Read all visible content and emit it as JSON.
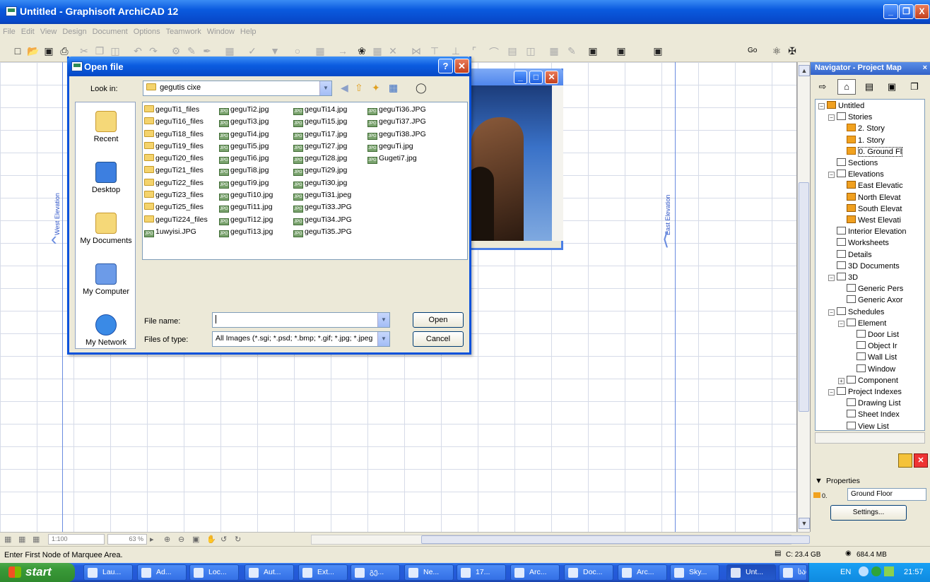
{
  "app": {
    "title": "Untitled - Graphisoft ArchiCAD 12",
    "window_buttons": [
      "_",
      "❐",
      "X"
    ]
  },
  "menu": [
    "File",
    "Edit",
    "View",
    "Design",
    "Document",
    "Options",
    "Teamwork",
    "Window",
    "Help"
  ],
  "toolbar_right": {
    "go": "Go"
  },
  "canvas": {
    "west_label": "West Elevation",
    "east_label": "East Elevation"
  },
  "bottom": {
    "scale": "1:100",
    "zoom": "63 %"
  },
  "status": {
    "message": "Enter First Node of Marquee Area.",
    "disk": "C: 23.4 GB",
    "memory": "684.4 MB"
  },
  "navigator": {
    "title": "Navigator - Project Map",
    "tree": [
      {
        "label": "Untitled",
        "level": 0,
        "icon": "house-icon"
      },
      {
        "label": "Stories",
        "level": 1,
        "icon": "stories-icon"
      },
      {
        "label": "2. Story",
        "level": 2,
        "icon": "story-icon"
      },
      {
        "label": "1. Story",
        "level": 2,
        "icon": "story-icon"
      },
      {
        "label": "0. Ground Fl",
        "level": 2,
        "icon": "story-icon"
      },
      {
        "label": "Sections",
        "level": 1,
        "icon": "section-icon"
      },
      {
        "label": "Elevations",
        "level": 1,
        "icon": "elevation-icon"
      },
      {
        "label": "East Elevatic",
        "level": 2,
        "icon": "house-icon"
      },
      {
        "label": "North Elevat",
        "level": 2,
        "icon": "house-icon"
      },
      {
        "label": "South Elevat",
        "level": 2,
        "icon": "house-icon"
      },
      {
        "label": "West Elevati",
        "level": 2,
        "icon": "house-icon"
      },
      {
        "label": "Interior Elevation",
        "level": 1,
        "icon": "interior-icon"
      },
      {
        "label": "Worksheets",
        "level": 1,
        "icon": "worksheet-icon"
      },
      {
        "label": "Details",
        "level": 1,
        "icon": "detail-icon"
      },
      {
        "label": "3D Documents",
        "level": 1,
        "icon": "3d-doc-icon"
      },
      {
        "label": "3D",
        "level": 1,
        "icon": "3d-icon"
      },
      {
        "label": "Generic Pers",
        "level": 2,
        "icon": "camera-icon"
      },
      {
        "label": "Generic Axor",
        "level": 2,
        "icon": "axon-icon"
      },
      {
        "label": "Schedules",
        "level": 1,
        "icon": "schedule-icon"
      },
      {
        "label": "Element",
        "level": 2,
        "icon": "element-icon"
      },
      {
        "label": "Door List",
        "level": 3,
        "icon": "list-icon"
      },
      {
        "label": "Object Ir",
        "level": 3,
        "icon": "list-icon"
      },
      {
        "label": "Wall List",
        "level": 3,
        "icon": "list-icon"
      },
      {
        "label": "Window",
        "level": 3,
        "icon": "list-icon"
      },
      {
        "label": "Component",
        "level": 2,
        "icon": "component-icon"
      },
      {
        "label": "Project Indexes",
        "level": 1,
        "icon": "index-icon"
      },
      {
        "label": "Drawing List",
        "level": 2,
        "icon": "index-item-icon"
      },
      {
        "label": "Sheet Index",
        "level": 2,
        "icon": "index-item-icon"
      },
      {
        "label": "View List",
        "level": 2,
        "icon": "index-item-icon"
      }
    ],
    "properties": {
      "label": "Properties",
      "story_num": "0.",
      "story_name": "Ground Floor",
      "settings_btn": "Settings..."
    }
  },
  "dialog": {
    "title": "Open file",
    "look_in_label": "Look in:",
    "look_in_value": "gegutis cixe",
    "places": [
      "Recent",
      "Desktop",
      "My Documents",
      "My Computer",
      "My Network"
    ],
    "columns": [
      [
        {
          "n": "geguTi1_files",
          "t": "folder"
        },
        {
          "n": "geguTi16_files",
          "t": "folder"
        },
        {
          "n": "geguTi18_files",
          "t": "folder"
        },
        {
          "n": "geguTi19_files",
          "t": "folder"
        },
        {
          "n": "geguTi20_files",
          "t": "folder"
        },
        {
          "n": "geguTi21_files",
          "t": "folder"
        },
        {
          "n": "geguTi22_files",
          "t": "folder"
        },
        {
          "n": "geguTi23_files",
          "t": "folder"
        },
        {
          "n": "geguTi25_files",
          "t": "folder"
        },
        {
          "n": "geguTi224_files",
          "t": "folder"
        },
        {
          "n": "1uwyisi.JPG",
          "t": "jpg"
        }
      ],
      [
        {
          "n": "geguTi2.jpg",
          "t": "jpg"
        },
        {
          "n": "geguTi3.jpg",
          "t": "jpg"
        },
        {
          "n": "geguTi4.jpg",
          "t": "jpg"
        },
        {
          "n": "geguTi5.jpg",
          "t": "jpg"
        },
        {
          "n": "geguTi6.jpg",
          "t": "jpg"
        },
        {
          "n": "geguTi8.jpg",
          "t": "jpg"
        },
        {
          "n": "geguTi9.jpg",
          "t": "jpg"
        },
        {
          "n": "geguTi10.jpg",
          "t": "jpg"
        },
        {
          "n": "geguTi11.jpg",
          "t": "jpg"
        },
        {
          "n": "geguTi12.jpg",
          "t": "jpg"
        },
        {
          "n": "geguTi13.jpg",
          "t": "jpg"
        }
      ],
      [
        {
          "n": "geguTi14.jpg",
          "t": "jpg"
        },
        {
          "n": "geguTi15.jpg",
          "t": "jpg"
        },
        {
          "n": "geguTi17.jpg",
          "t": "jpg"
        },
        {
          "n": "geguTi27.jpg",
          "t": "jpg"
        },
        {
          "n": "geguTi28.jpg",
          "t": "jpg"
        },
        {
          "n": "geguTi29.jpg",
          "t": "jpg"
        },
        {
          "n": "geguTi30.jpg",
          "t": "jpg"
        },
        {
          "n": "geguTi31.jpeg",
          "t": "jpg"
        },
        {
          "n": "geguTi33.JPG",
          "t": "jpg"
        },
        {
          "n": "geguTi34.JPG",
          "t": "jpg"
        },
        {
          "n": "geguTi35.JPG",
          "t": "jpg"
        }
      ],
      [
        {
          "n": "geguTi36.JPG",
          "t": "jpg"
        },
        {
          "n": "geguTi37.JPG",
          "t": "jpg"
        },
        {
          "n": "geguTi38.JPG",
          "t": "jpg"
        },
        {
          "n": "geguTi.jpg",
          "t": "jpg"
        },
        {
          "n": "Gugeti7.jpg",
          "t": "jpg"
        }
      ]
    ],
    "file_name_label": "File name:",
    "file_name_value": "",
    "file_type_label": "Files of type:",
    "file_type_value": "All Images (*.sgi; *.psd; *.bmp; *.gif; *.jpg; *.jpeg",
    "open_btn": "Open",
    "cancel_btn": "Cancel"
  },
  "taskbar": {
    "start": "start",
    "tasks": [
      "Lau...",
      "Ad...",
      "Loc...",
      "Aut...",
      "Ext...",
      "გე...",
      "Ne...",
      "17...",
      "Arc...",
      "Doc...",
      "Arc...",
      "Sky...",
      "Unt...",
      "სად..."
    ],
    "lang": "EN",
    "clock": "21:57"
  },
  "colors": {
    "xp_blue": "#0a5adf",
    "start_green": "#3a9a38",
    "grid": "#d6dbe8",
    "elevation_marker": "#6a8ce0"
  }
}
